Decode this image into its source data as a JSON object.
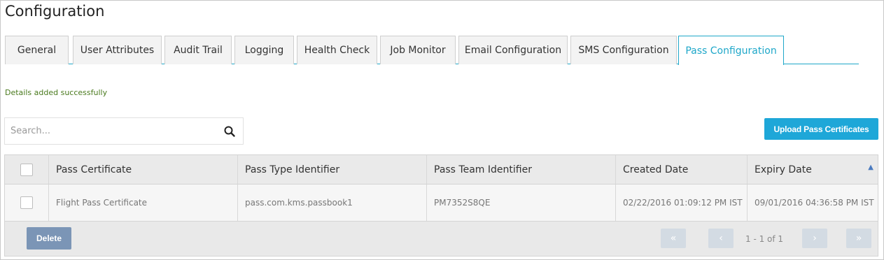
{
  "page": {
    "title": "Configuration"
  },
  "tabs": [
    {
      "label": "General"
    },
    {
      "label": "User Attributes"
    },
    {
      "label": "Audit Trail"
    },
    {
      "label": "Logging"
    },
    {
      "label": "Health Check"
    },
    {
      "label": "Job Monitor"
    },
    {
      "label": "Email Configuration"
    },
    {
      "label": "SMS Configuration"
    },
    {
      "label": "Pass Configuration",
      "active": true
    }
  ],
  "status": {
    "message": "Details added successfully"
  },
  "search": {
    "placeholder": "Search...",
    "value": ""
  },
  "toolbar": {
    "upload_label": "Upload Pass Certificates"
  },
  "table": {
    "columns": [
      "Pass Certificate",
      "Pass Type Identifier",
      "Pass Team Identifier",
      "Created Date",
      "Expiry Date"
    ],
    "sort": {
      "column": "Expiry Date",
      "direction": "ascending"
    },
    "rows": [
      {
        "pass_certificate": "Flight Pass Certificate",
        "pass_type_identifier": "pass.com.kms.passbook1",
        "pass_team_identifier": "PM7352S8QE",
        "created_date": "02/22/2016 01:09:12 PM IST",
        "expiry_date": "09/01/2016 04:36:58 PM IST"
      }
    ]
  },
  "footer": {
    "delete_label": "Delete",
    "pagination": {
      "info": "1 - 1 of 1",
      "first": "«",
      "prev": "‹",
      "next": "›",
      "last": "»"
    }
  },
  "colors": {
    "accent": "#1ea7d8",
    "success": "#4a7a1e",
    "delete": "#7b95b6"
  }
}
